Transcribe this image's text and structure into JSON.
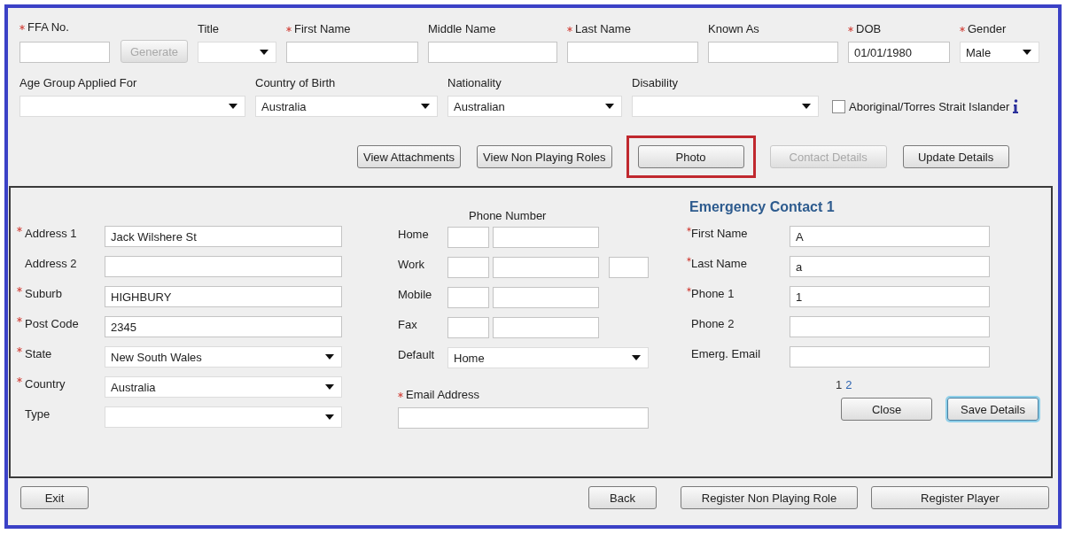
{
  "personal_row": [
    {
      "kind": "text",
      "label": "FFA No.",
      "required": true,
      "button": {
        "label": "Generate",
        "disabled": true
      }
    },
    {
      "kind": "select",
      "label": "Title",
      "required": false
    },
    {
      "kind": "text",
      "label": "First Name",
      "required": true
    },
    {
      "kind": "text",
      "label": "Middle Name",
      "required": false
    },
    {
      "kind": "text",
      "label": "Last Name",
      "required": true
    },
    {
      "kind": "text",
      "label": "Known As",
      "required": false
    },
    {
      "kind": "text",
      "label": "DOB",
      "required": true,
      "value": "01/01/1980"
    },
    {
      "kind": "select",
      "label": "Gender",
      "required": true,
      "value": "Male"
    }
  ],
  "details_row": [
    {
      "kind": "select",
      "label": "Age Group Applied For",
      "required": false
    },
    {
      "kind": "select",
      "label": "Country of Birth",
      "required": false,
      "value": "Australia"
    },
    {
      "kind": "select",
      "label": "Nationality",
      "required": false,
      "value": "Australian"
    },
    {
      "kind": "select",
      "label": "Disability",
      "required": false
    }
  ],
  "indigenous_checkbox": {
    "label": "Aboriginal/Torres Strait Islander",
    "checked": false
  },
  "actions": [
    {
      "label": "View Attachments",
      "disabled": false,
      "highlighted": false
    },
    {
      "label": "View Non Playing Roles",
      "disabled": false,
      "highlighted": false
    },
    {
      "label": "Photo",
      "disabled": false,
      "highlighted": true
    },
    {
      "label": "Contact Details",
      "disabled": true,
      "highlighted": false
    },
    {
      "label": "Update Details",
      "disabled": false,
      "highlighted": false
    }
  ],
  "address": [
    {
      "kind": "text",
      "label": "Address 1",
      "required": true,
      "value": "Jack Wilshere St"
    },
    {
      "kind": "text",
      "label": "Address 2",
      "required": false
    },
    {
      "kind": "text",
      "label": "Suburb",
      "required": true,
      "value": "HIGHBURY"
    },
    {
      "kind": "text",
      "label": "Post Code",
      "required": true,
      "value": "2345"
    },
    {
      "kind": "select",
      "label": "State",
      "required": true,
      "value": "New South Wales"
    },
    {
      "kind": "select",
      "label": "Country",
      "required": true,
      "value": "Australia"
    },
    {
      "kind": "select",
      "label": "Type",
      "required": false
    }
  ],
  "phone": {
    "title": "Phone Number",
    "rows": [
      {
        "label": "Home",
        "extension": false
      },
      {
        "label": "Work",
        "extension": true
      },
      {
        "label": "Mobile",
        "extension": false
      },
      {
        "label": "Fax",
        "extension": false
      }
    ],
    "default": {
      "label": "Default",
      "value": "Home"
    },
    "email": {
      "label": "Email Address",
      "required": true
    }
  },
  "emergency": {
    "title": "Emergency Contact 1",
    "fields": [
      {
        "label": "First Name",
        "required": true,
        "value": "A"
      },
      {
        "label": "Last Name",
        "required": true,
        "value": "a"
      },
      {
        "label": "Phone 1",
        "required": true,
        "value": "1"
      },
      {
        "label": "Phone 2",
        "required": false
      },
      {
        "label": "Emerg. Email",
        "required": false
      }
    ],
    "pages": [
      {
        "label": "1",
        "selected": true
      },
      {
        "label": "2",
        "selected": false
      }
    ],
    "buttons": [
      {
        "label": "Close",
        "focused": false
      },
      {
        "label": "Save Details",
        "focused": true
      }
    ]
  },
  "footer": {
    "left": [
      {
        "label": "Exit"
      }
    ],
    "right": [
      {
        "label": "Back"
      },
      {
        "label": "Register Non Playing Role"
      },
      {
        "label": "Register Player"
      }
    ]
  }
}
